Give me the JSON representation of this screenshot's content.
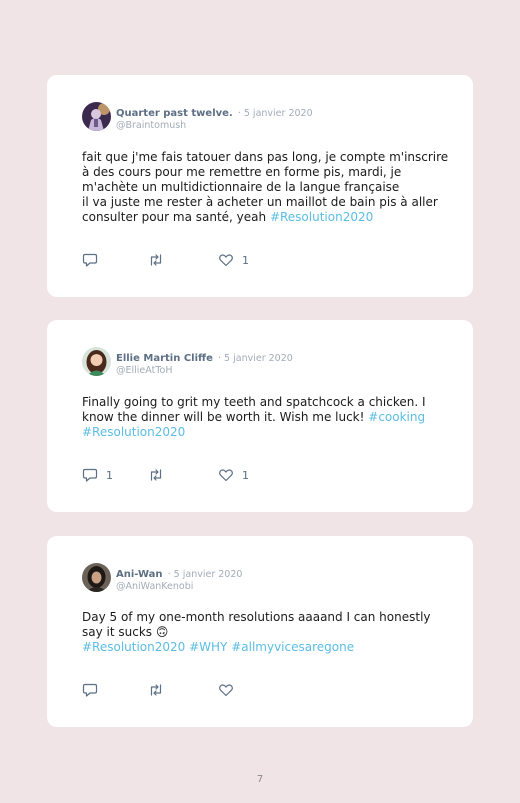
{
  "tweets": [
    {
      "name": "Quarter past twelve.",
      "date": "· 5 janvier 2020",
      "handle": "@Braintomush",
      "lines": [
        [
          {
            "t": "fait que j'me fais tatouer dans pas long, je compte m'inscrire"
          }
        ],
        [
          {
            "t": "à des cours pour me remettre en forme pis, mardi, je"
          }
        ],
        [
          {
            "t": "m'achète un multidictionnaire de la langue française"
          }
        ],
        [
          {
            "t": "il va juste me rester à acheter un maillot de bain pis à aller"
          }
        ],
        [
          {
            "t": "consulter pour ma santé, yeah "
          },
          {
            "t": "#Resolution2020",
            "tag": true
          }
        ]
      ],
      "replies": "",
      "retweets": "",
      "likes": "1",
      "avatar_icon": "avatar-quarter-past-twelve"
    },
    {
      "name": "Ellie Martin Cliffe",
      "date": "· 5 janvier 2020",
      "handle": "@EllieAtToH",
      "lines": [
        [
          {
            "t": "Finally going to grit my teeth and spatchcock a chicken. I"
          }
        ],
        [
          {
            "t": "know the dinner will be worth it. Wish me luck! "
          },
          {
            "t": "#cooking",
            "tag": true
          }
        ],
        [
          {
            "t": "#Resolution2020",
            "tag": true
          }
        ]
      ],
      "replies": "1",
      "retweets": "",
      "likes": "1",
      "avatar_icon": "avatar-ellie"
    },
    {
      "name": "Ani-Wan",
      "date": "· 5 janvier 2020",
      "handle": "@AniWanKenobi",
      "lines": [
        [
          {
            "t": "Day 5 of my one-month resolutions aaaand I can honestly"
          }
        ],
        [
          {
            "t": "say it sucks 🙃"
          }
        ],
        [
          {
            "t": "#Resolution2020 #WHY #allmyvicesaregone",
            "tag": true
          }
        ]
      ],
      "replies": "",
      "retweets": "",
      "likes": "",
      "avatar_icon": "avatar-ani-wan"
    }
  ],
  "icons": {
    "reply": "reply-icon",
    "retweet": "retweet-icon",
    "like": "heart-icon"
  },
  "colors": {
    "background": "#f0e4e6",
    "card": "#ffffff",
    "name": "#5d6f85",
    "meta": "#a2acb8",
    "hashtag": "#5bbde4"
  },
  "page_number": "7"
}
